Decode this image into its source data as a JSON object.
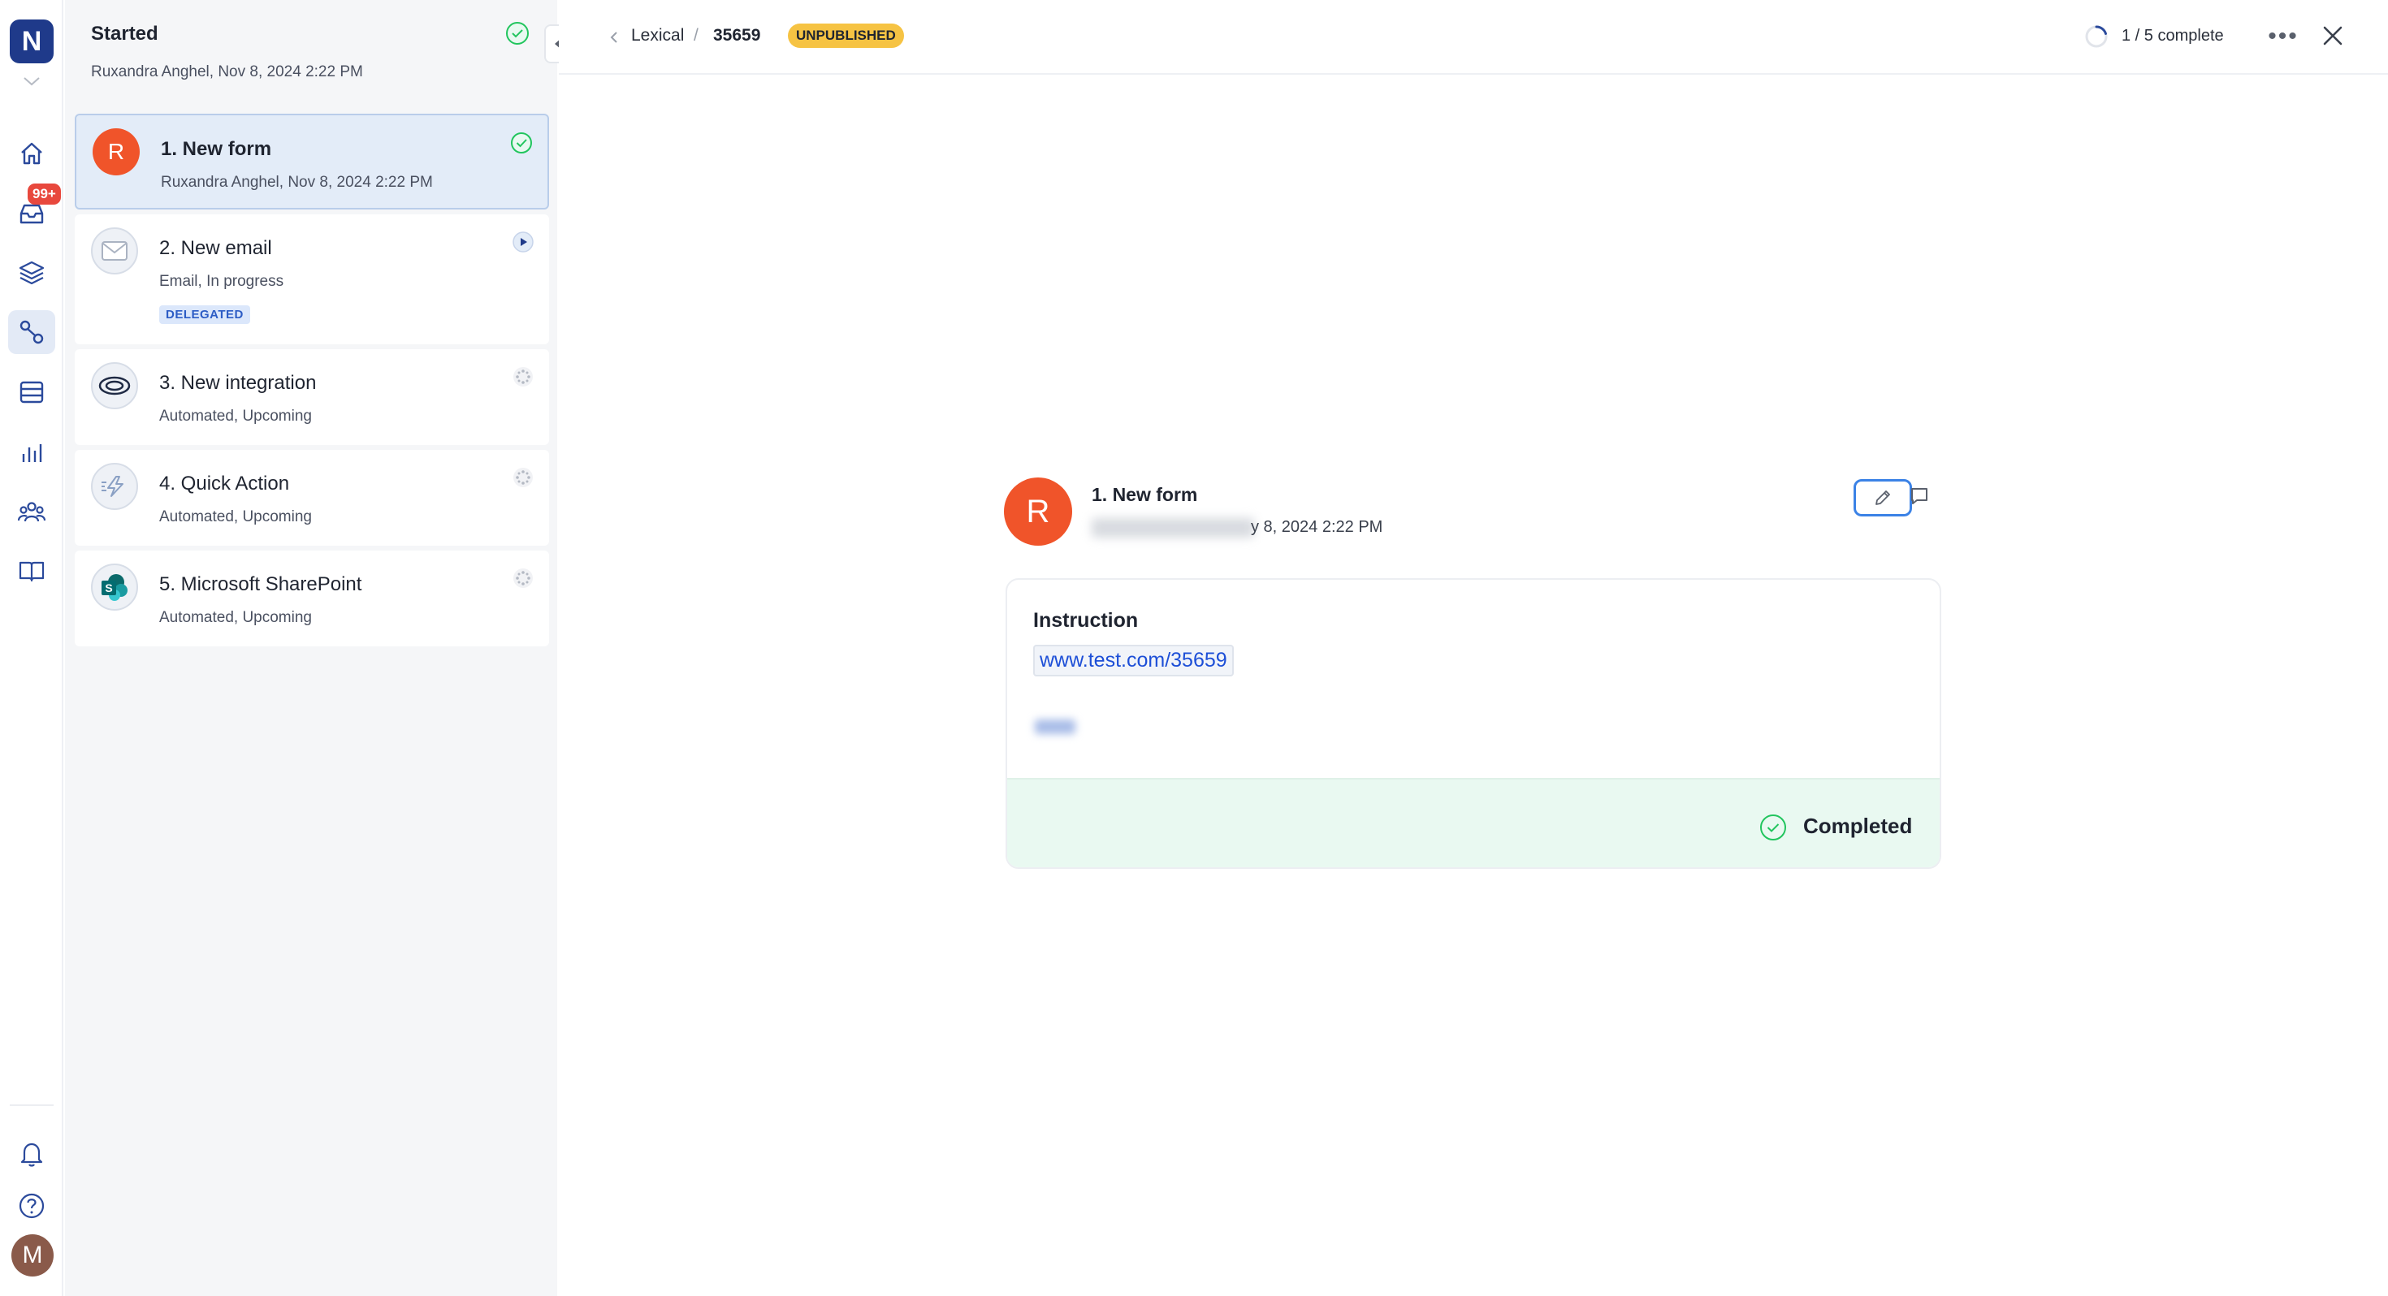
{
  "rail": {
    "logo_letter": "N",
    "inbox_badge": "99+",
    "user_initial": "M",
    "items": [
      "home-icon",
      "inbox-icon",
      "layers-icon",
      "workflow-icon",
      "list-icon",
      "chart-icon",
      "team-icon",
      "book-icon"
    ],
    "bottom_items": [
      "bell-icon",
      "help-icon"
    ]
  },
  "panel": {
    "title": "Started",
    "subtitle": "Ruxandra Anghel, Nov 8, 2024 2:22 PM",
    "steps": [
      {
        "label": "1.  New form",
        "sub": "Ruxandra Anghel, Nov 8, 2024 2:22 PM",
        "icon": "avatar-r",
        "avatar_letter": "R",
        "status": "completed-check-icon"
      },
      {
        "label": "2.  New email",
        "sub": "Email, In progress",
        "badge": "DELEGATED",
        "icon": "email-icon",
        "status": "play-icon"
      },
      {
        "label": "3.  New integration",
        "sub": "Automated, Upcoming",
        "icon": "integration-icon",
        "status": "pending-icon"
      },
      {
        "label": "4.  Quick Action",
        "sub": "Automated, Upcoming",
        "icon": "quick-action-icon",
        "status": "pending-icon"
      },
      {
        "label": "5.  Microsoft SharePoint",
        "sub": "Automated, Upcoming",
        "icon": "sharepoint-icon",
        "status": "pending-icon"
      }
    ]
  },
  "topbar": {
    "breadcrumb_parent": "Lexical",
    "breadcrumb_sep": "/",
    "breadcrumb_id": "35659",
    "status_badge": "UNPUBLISHED",
    "progress_text": "1 / 5 complete",
    "progress_fraction": 0.2,
    "more_label": "•••"
  },
  "detail": {
    "avatar_letter": "R",
    "title": "1. New form",
    "date_visible": "y 8, 2024 2:22 PM",
    "field_label": "Instruction",
    "link_text": "www.test.com/35659",
    "status_text": "Completed"
  },
  "colors": {
    "brand": "#1f3a8a",
    "accent": "#3b82e6",
    "success": "#22c55e",
    "avatar": "#f0542a",
    "warning_badge": "#f6c343",
    "notification": "#e8483d"
  }
}
